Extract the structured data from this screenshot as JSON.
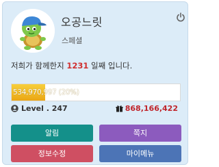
{
  "profile": {
    "nickname": "오공느릿",
    "grade": "스페셜"
  },
  "days": {
    "before": "저희가 함께한지 ",
    "count": "1231",
    "after": " 일째 입니다."
  },
  "experience": {
    "text": "534,970,997 (20%)",
    "percent": 20
  },
  "level": {
    "text": "Level . 247"
  },
  "points": {
    "value": "868,166,422"
  },
  "buttons": {
    "alerts": "알림",
    "messages": "쪽지",
    "edit_profile": "정보수정",
    "my_menu": "마이메뉴"
  },
  "colors": {
    "card_bg": "#dcecf8",
    "points_red": "#c0242a",
    "exp_fill": "#eaa615",
    "alerts_btn": "#14908a",
    "messages_btn": "#8c5bbe",
    "edit_btn": "#cf4f62",
    "menu_btn": "#4c74b6"
  },
  "icons": {
    "logout": "power-icon",
    "level": "user-icon",
    "points": "gift-icon"
  }
}
